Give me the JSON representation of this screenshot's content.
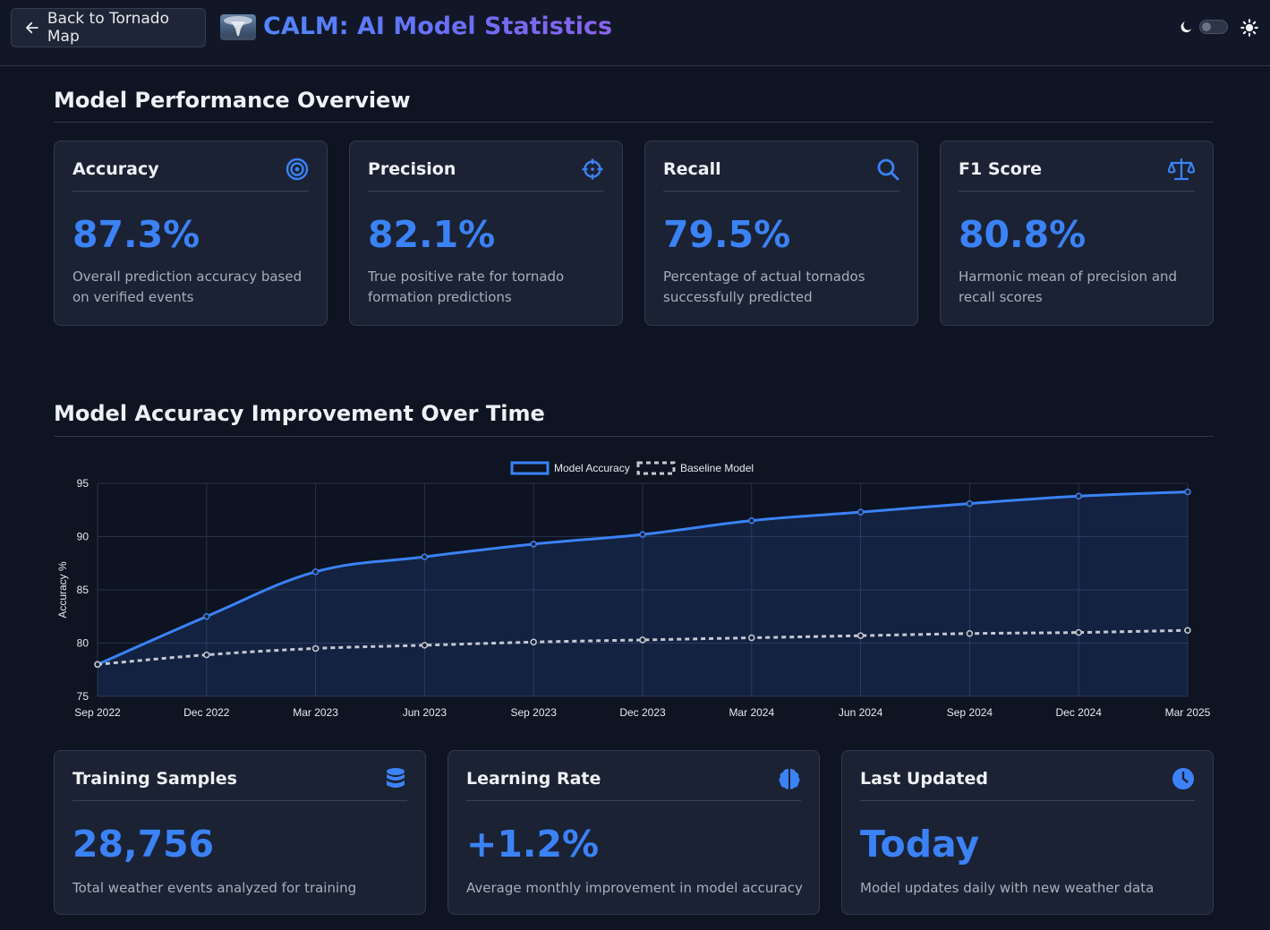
{
  "header": {
    "back_label": "Back to Tornado Map",
    "title": "CALM: AI Model Statistics"
  },
  "overview": {
    "title": "Model Performance Overview",
    "cards": [
      {
        "title": "Accuracy",
        "value": "87.3%",
        "desc": "Overall prediction accuracy based on verified events",
        "icon": "target-icon"
      },
      {
        "title": "Precision",
        "value": "82.1%",
        "desc": "True positive rate for tornado formation predictions",
        "icon": "crosshair-icon"
      },
      {
        "title": "Recall",
        "value": "79.5%",
        "desc": "Percentage of actual tornados successfully predicted",
        "icon": "search-icon"
      },
      {
        "title": "F1 Score",
        "value": "80.8%",
        "desc": "Harmonic mean of precision and recall scores",
        "icon": "balance-scale-icon"
      }
    ]
  },
  "improvement": {
    "title": "Model Accuracy Improvement Over Time"
  },
  "chart_data": {
    "type": "line",
    "x": [
      "Sep 2022",
      "Dec 2022",
      "Mar 2023",
      "Jun 2023",
      "Sep 2023",
      "Dec 2023",
      "Mar 2024",
      "Jun 2024",
      "Sep 2024",
      "Dec 2024",
      "Mar 2025"
    ],
    "series": [
      {
        "name": "Model Accuracy",
        "values": [
          78.0,
          82.5,
          86.7,
          88.1,
          89.3,
          90.2,
          91.5,
          92.3,
          93.1,
          93.8,
          94.2
        ],
        "color": "#3b82f6",
        "style": "solid",
        "fill": true
      },
      {
        "name": "Baseline Model",
        "values": [
          78.0,
          78.9,
          79.5,
          79.8,
          80.1,
          80.3,
          80.5,
          80.7,
          80.9,
          81.0,
          81.2
        ],
        "color": "#c3c8d2",
        "style": "dashed",
        "fill": false
      }
    ],
    "ylabel": "Accuracy %",
    "xlabel": "",
    "ylim": [
      75,
      95
    ],
    "yticks": [
      75,
      80,
      85,
      90,
      95
    ],
    "grid": true,
    "legend": "top-center"
  },
  "stats": {
    "cards": [
      {
        "title": "Training Samples",
        "value": "28,756",
        "desc": "Total weather events analyzed for training",
        "icon": "database-icon"
      },
      {
        "title": "Learning Rate",
        "value": "+1.2%",
        "desc": "Average monthly improvement in model accuracy",
        "icon": "brain-icon"
      },
      {
        "title": "Last Updated",
        "value": "Today",
        "desc": "Model updates daily with new weather data",
        "icon": "clock-icon"
      }
    ]
  },
  "colors": {
    "accent": "#3b82f6",
    "background": "#0f1422",
    "card": "#1b2233"
  }
}
